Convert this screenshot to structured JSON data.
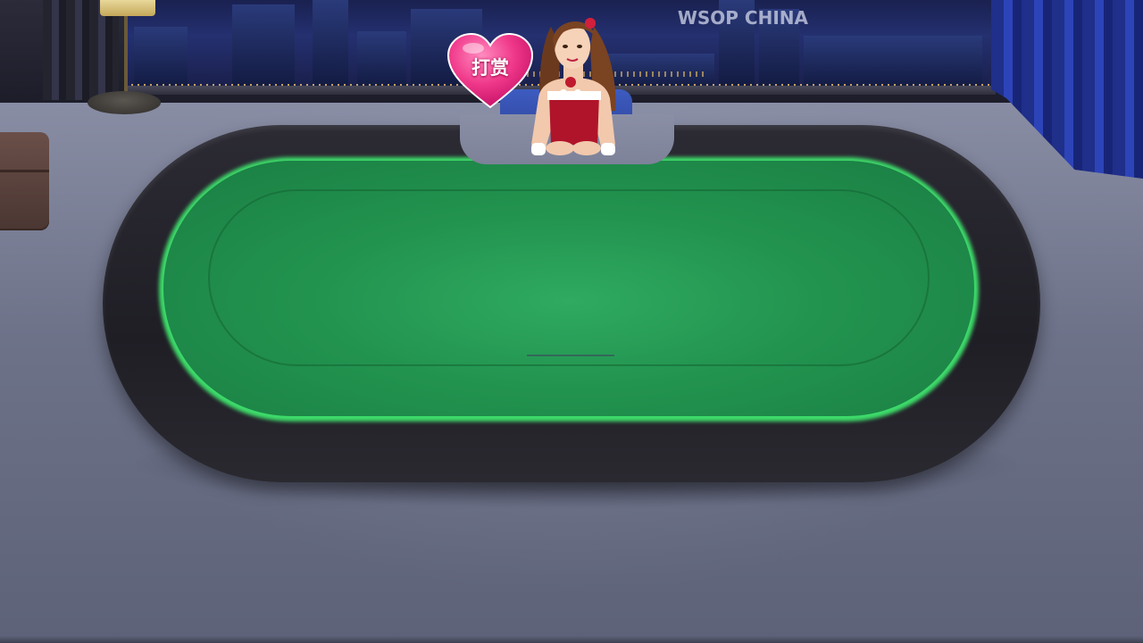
{
  "scene": {
    "watermark": "WSOP CHINA",
    "tip_button_label": "打赏",
    "colors": {
      "felt": "#22934f",
      "felt_glow": "#3ddc6a",
      "rail": "#1f1e25",
      "floor": "#6d7289",
      "tip_heart": "#f0388a",
      "curtain_right": "#2d44b8"
    },
    "icons": {
      "tip": "heart-icon",
      "dealer": "dealer-avatar"
    }
  }
}
